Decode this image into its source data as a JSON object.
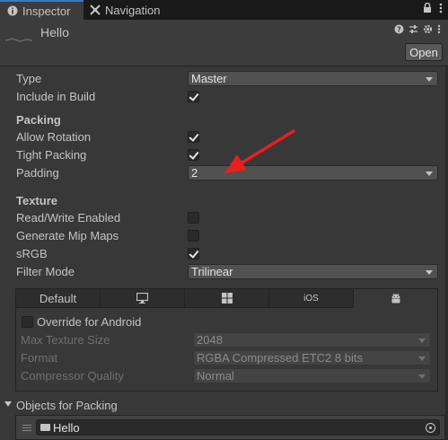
{
  "tabs": [
    {
      "label": "Inspector",
      "icon": "info-icon"
    },
    {
      "label": "Navigation",
      "icon": "navigation-icon"
    }
  ],
  "header": {
    "title": "Hello",
    "open_label": "Open"
  },
  "type": {
    "label": "Type",
    "value": "Master"
  },
  "include_in_build": {
    "label": "Include in Build",
    "checked": true
  },
  "packing": {
    "title": "Packing",
    "allow_rotation": {
      "label": "Allow Rotation",
      "checked": true
    },
    "tight_packing": {
      "label": "Tight Packing",
      "checked": true
    },
    "padding": {
      "label": "Padding",
      "value": "2"
    }
  },
  "texture": {
    "title": "Texture",
    "read_write": {
      "label": "Read/Write Enabled",
      "checked": false
    },
    "mip_maps": {
      "label": "Generate Mip Maps",
      "checked": false
    },
    "srgb": {
      "label": "sRGB",
      "checked": true
    },
    "filter_mode": {
      "label": "Filter Mode",
      "value": "Trilinear"
    }
  },
  "platform_tabs": [
    {
      "label": "Default"
    },
    {
      "icon": "monitor-icon"
    },
    {
      "icon": "windows-icon"
    },
    {
      "label": "iOS"
    },
    {
      "icon": "android-icon"
    }
  ],
  "platform": {
    "override": {
      "label": "Override for Android",
      "checked": false
    },
    "max_size": {
      "label": "Max Texture Size",
      "value": "2048"
    },
    "format": {
      "label": "Format",
      "value": "RGBA Compressed ETC2 8 bits"
    },
    "quality": {
      "label": "Compressor Quality",
      "value": "Normal"
    }
  },
  "objects": {
    "title": "Objects for Packing",
    "items": [
      {
        "name": "Hello"
      }
    ]
  },
  "colors": {
    "accent": "#3a79bb",
    "annotation_arrow": "#e8201e"
  }
}
